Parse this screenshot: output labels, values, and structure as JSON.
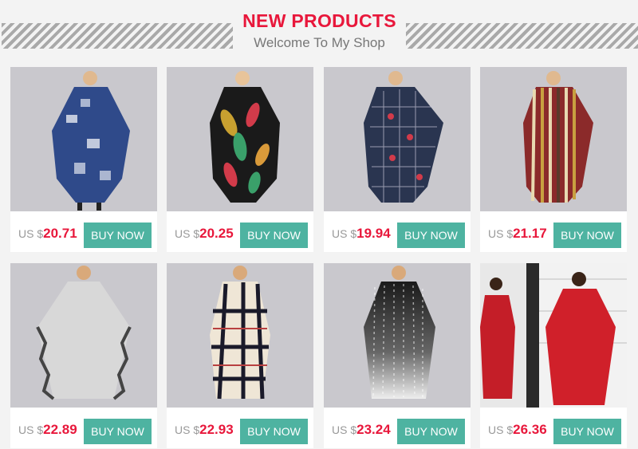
{
  "header": {
    "title": "NEW PRODUCTS",
    "subtitle": "Welcome To My Shop"
  },
  "products": [
    {
      "currency": "US $",
      "price": "20.71",
      "buy_label": "BUY NOW",
      "color": "#2f4a8a"
    },
    {
      "currency": "US $",
      "price": "20.25",
      "buy_label": "BUY NOW",
      "color": "#1a1a1a"
    },
    {
      "currency": "US $",
      "price": "19.94",
      "buy_label": "BUY NOW",
      "color": "#2a3550"
    },
    {
      "currency": "US $",
      "price": "21.17",
      "buy_label": "BUY NOW",
      "color": "#8b2a2a"
    },
    {
      "currency": "US $",
      "price": "22.89",
      "buy_label": "BUY NOW",
      "color": "#d8d8d8"
    },
    {
      "currency": "US $",
      "price": "22.93",
      "buy_label": "BUY NOW",
      "color": "#efe6d6"
    },
    {
      "currency": "US $",
      "price": "23.24",
      "buy_label": "BUY NOW",
      "color": "#777777"
    },
    {
      "currency": "US $",
      "price": "26.36",
      "buy_label": "BUY NOW",
      "color": "#d0202a"
    }
  ]
}
